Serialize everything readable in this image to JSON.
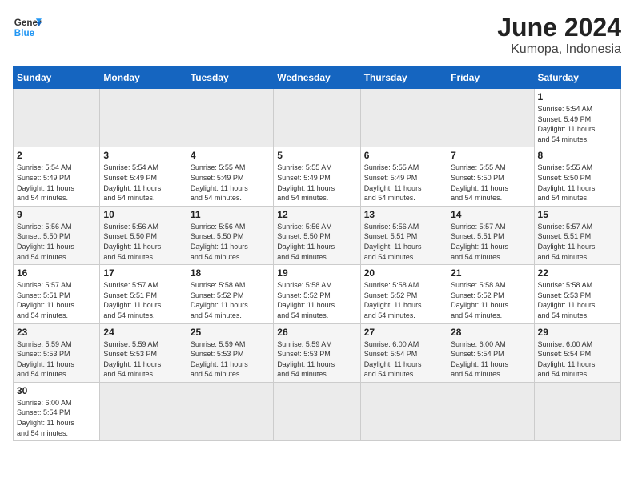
{
  "header": {
    "logo_general": "General",
    "logo_blue": "Blue",
    "month_year": "June 2024",
    "location": "Kumopa, Indonesia"
  },
  "weekdays": [
    "Sunday",
    "Monday",
    "Tuesday",
    "Wednesday",
    "Thursday",
    "Friday",
    "Saturday"
  ],
  "weeks": [
    {
      "days": [
        {
          "number": "",
          "info": "",
          "empty": true
        },
        {
          "number": "",
          "info": "",
          "empty": true
        },
        {
          "number": "",
          "info": "",
          "empty": true
        },
        {
          "number": "",
          "info": "",
          "empty": true
        },
        {
          "number": "",
          "info": "",
          "empty": true
        },
        {
          "number": "",
          "info": "",
          "empty": true
        },
        {
          "number": "1",
          "info": "Sunrise: 5:54 AM\nSunset: 5:49 PM\nDaylight: 11 hours\nand 54 minutes."
        }
      ]
    },
    {
      "days": [
        {
          "number": "2",
          "info": "Sunrise: 5:54 AM\nSunset: 5:49 PM\nDaylight: 11 hours\nand 54 minutes."
        },
        {
          "number": "3",
          "info": "Sunrise: 5:54 AM\nSunset: 5:49 PM\nDaylight: 11 hours\nand 54 minutes."
        },
        {
          "number": "4",
          "info": "Sunrise: 5:55 AM\nSunset: 5:49 PM\nDaylight: 11 hours\nand 54 minutes."
        },
        {
          "number": "5",
          "info": "Sunrise: 5:55 AM\nSunset: 5:49 PM\nDaylight: 11 hours\nand 54 minutes."
        },
        {
          "number": "6",
          "info": "Sunrise: 5:55 AM\nSunset: 5:49 PM\nDaylight: 11 hours\nand 54 minutes."
        },
        {
          "number": "7",
          "info": "Sunrise: 5:55 AM\nSunset: 5:50 PM\nDaylight: 11 hours\nand 54 minutes."
        },
        {
          "number": "8",
          "info": "Sunrise: 5:55 AM\nSunset: 5:50 PM\nDaylight: 11 hours\nand 54 minutes."
        }
      ]
    },
    {
      "days": [
        {
          "number": "9",
          "info": "Sunrise: 5:56 AM\nSunset: 5:50 PM\nDaylight: 11 hours\nand 54 minutes."
        },
        {
          "number": "10",
          "info": "Sunrise: 5:56 AM\nSunset: 5:50 PM\nDaylight: 11 hours\nand 54 minutes."
        },
        {
          "number": "11",
          "info": "Sunrise: 5:56 AM\nSunset: 5:50 PM\nDaylight: 11 hours\nand 54 minutes."
        },
        {
          "number": "12",
          "info": "Sunrise: 5:56 AM\nSunset: 5:50 PM\nDaylight: 11 hours\nand 54 minutes."
        },
        {
          "number": "13",
          "info": "Sunrise: 5:56 AM\nSunset: 5:51 PM\nDaylight: 11 hours\nand 54 minutes."
        },
        {
          "number": "14",
          "info": "Sunrise: 5:57 AM\nSunset: 5:51 PM\nDaylight: 11 hours\nand 54 minutes."
        },
        {
          "number": "15",
          "info": "Sunrise: 5:57 AM\nSunset: 5:51 PM\nDaylight: 11 hours\nand 54 minutes."
        }
      ]
    },
    {
      "days": [
        {
          "number": "16",
          "info": "Sunrise: 5:57 AM\nSunset: 5:51 PM\nDaylight: 11 hours\nand 54 minutes."
        },
        {
          "number": "17",
          "info": "Sunrise: 5:57 AM\nSunset: 5:51 PM\nDaylight: 11 hours\nand 54 minutes."
        },
        {
          "number": "18",
          "info": "Sunrise: 5:58 AM\nSunset: 5:52 PM\nDaylight: 11 hours\nand 54 minutes."
        },
        {
          "number": "19",
          "info": "Sunrise: 5:58 AM\nSunset: 5:52 PM\nDaylight: 11 hours\nand 54 minutes."
        },
        {
          "number": "20",
          "info": "Sunrise: 5:58 AM\nSunset: 5:52 PM\nDaylight: 11 hours\nand 54 minutes."
        },
        {
          "number": "21",
          "info": "Sunrise: 5:58 AM\nSunset: 5:52 PM\nDaylight: 11 hours\nand 54 minutes."
        },
        {
          "number": "22",
          "info": "Sunrise: 5:58 AM\nSunset: 5:53 PM\nDaylight: 11 hours\nand 54 minutes."
        }
      ]
    },
    {
      "days": [
        {
          "number": "23",
          "info": "Sunrise: 5:59 AM\nSunset: 5:53 PM\nDaylight: 11 hours\nand 54 minutes."
        },
        {
          "number": "24",
          "info": "Sunrise: 5:59 AM\nSunset: 5:53 PM\nDaylight: 11 hours\nand 54 minutes."
        },
        {
          "number": "25",
          "info": "Sunrise: 5:59 AM\nSunset: 5:53 PM\nDaylight: 11 hours\nand 54 minutes."
        },
        {
          "number": "26",
          "info": "Sunrise: 5:59 AM\nSunset: 5:53 PM\nDaylight: 11 hours\nand 54 minutes."
        },
        {
          "number": "27",
          "info": "Sunrise: 6:00 AM\nSunset: 5:54 PM\nDaylight: 11 hours\nand 54 minutes."
        },
        {
          "number": "28",
          "info": "Sunrise: 6:00 AM\nSunset: 5:54 PM\nDaylight: 11 hours\nand 54 minutes."
        },
        {
          "number": "29",
          "info": "Sunrise: 6:00 AM\nSunset: 5:54 PM\nDaylight: 11 hours\nand 54 minutes."
        }
      ]
    },
    {
      "days": [
        {
          "number": "30",
          "info": "Sunrise: 6:00 AM\nSunset: 5:54 PM\nDaylight: 11 hours\nand 54 minutes."
        },
        {
          "number": "",
          "info": "",
          "empty": true
        },
        {
          "number": "",
          "info": "",
          "empty": true
        },
        {
          "number": "",
          "info": "",
          "empty": true
        },
        {
          "number": "",
          "info": "",
          "empty": true
        },
        {
          "number": "",
          "info": "",
          "empty": true
        },
        {
          "number": "",
          "info": "",
          "empty": true
        }
      ]
    }
  ]
}
